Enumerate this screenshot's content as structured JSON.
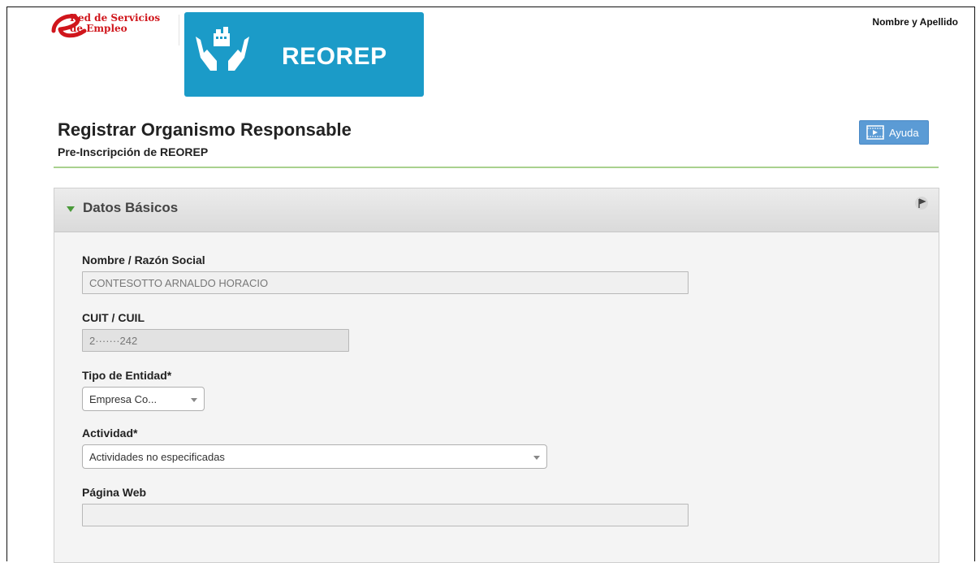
{
  "header": {
    "brand_text": "Red de Servicios\nde Empleo",
    "banner_title": "REOREP",
    "user_name": "Nombre y Apellido"
  },
  "page": {
    "title": "Registrar Organismo Responsable",
    "subtitle": "Pre-Inscripción de REOREP",
    "help_label": "Ayuda"
  },
  "section": {
    "title": "Datos Básicos",
    "fields": {
      "razon_social_label": "Nombre / Razón Social",
      "razon_social_value": "CONTESOTTO ARNALDO HORACIO",
      "cuit_label": "CUIT / CUIL",
      "cuit_value": "2·······242",
      "tipo_entidad_label": "Tipo de Entidad*",
      "tipo_entidad_value": "Empresa Co...",
      "actividad_label": "Actividad*",
      "actividad_value": "Actividades no especificadas",
      "pagina_web_label": "Página Web",
      "pagina_web_value": ""
    }
  },
  "colors": {
    "brand_red": "#d0161c",
    "banner_blue": "#1b9bc8",
    "accent_green": "#a9d18e",
    "help_blue": "#5b9bd5"
  }
}
